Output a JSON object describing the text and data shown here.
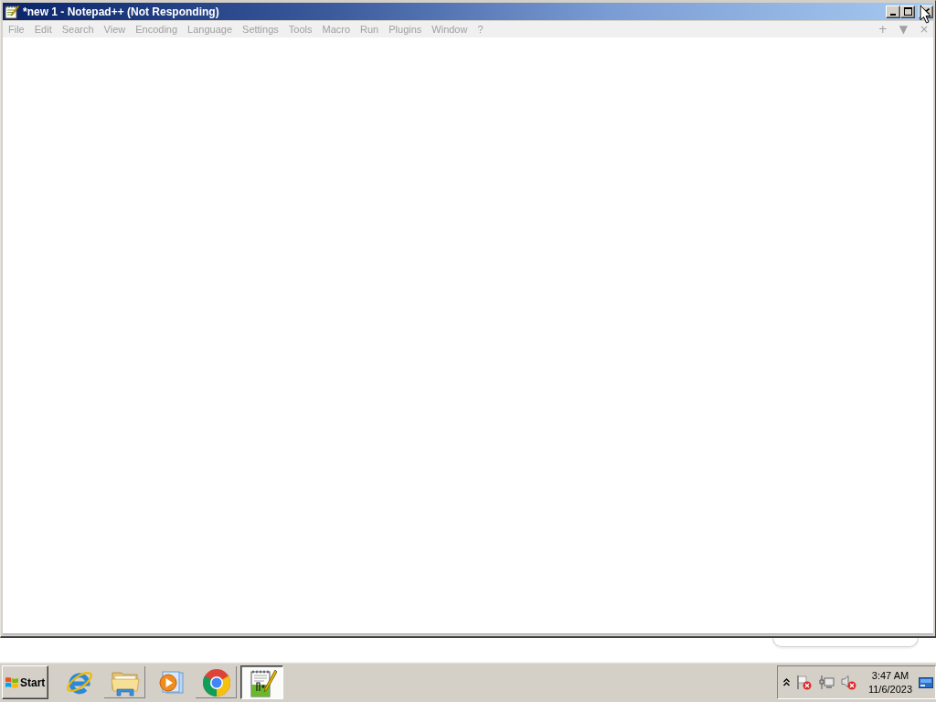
{
  "window": {
    "title": "*new 1 - Notepad++ (Not Responding)"
  },
  "menu": [
    {
      "label": "File",
      "disabled": true
    },
    {
      "label": "Edit",
      "disabled": true
    },
    {
      "label": "Search",
      "disabled": true
    },
    {
      "label": "View",
      "disabled": true
    },
    {
      "label": "Encoding",
      "disabled": true
    },
    {
      "label": "Language",
      "disabled": true
    },
    {
      "label": "Settings",
      "disabled": true
    },
    {
      "label": "Tools",
      "disabled": true
    },
    {
      "label": "Macro",
      "disabled": true
    },
    {
      "label": "Run",
      "disabled": true
    },
    {
      "label": "Plugins",
      "disabled": true
    },
    {
      "label": "Window",
      "disabled": true
    },
    {
      "label": "?",
      "disabled": true
    }
  ],
  "tab_bar_buttons": [
    {
      "label": "+",
      "disabled": true
    },
    {
      "label": "▼",
      "disabled": true
    },
    {
      "label": "×",
      "disabled": true
    }
  ],
  "taskbar": {
    "start": "Start",
    "buttons": [
      {
        "running": false,
        "selected": false
      },
      {
        "running": true,
        "selected": false
      },
      {
        "running": false,
        "selected": false
      },
      {
        "running": true,
        "selected": false
      },
      {
        "running": true,
        "selected": true
      }
    ]
  },
  "tray": {
    "time": "3:47 AM",
    "date": "11/6/2023"
  }
}
